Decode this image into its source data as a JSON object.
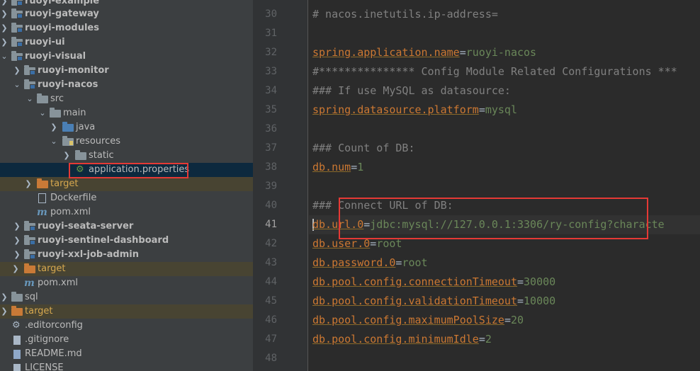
{
  "project_tree": {
    "items": [
      {
        "label": "ruoyi-example",
        "icon": "module-folder-icon"
      },
      {
        "label": "ruoyi-gateway",
        "icon": "module-folder-icon"
      },
      {
        "label": "ruoyi-modules",
        "icon": "module-folder-icon"
      },
      {
        "label": "ruoyi-ui",
        "icon": "module-folder-icon"
      },
      {
        "label": "ruoyi-visual",
        "icon": "module-folder-icon"
      },
      {
        "label": "ruoyi-monitor",
        "icon": "module-folder-icon"
      },
      {
        "label": "ruoyi-nacos",
        "icon": "module-folder-icon"
      },
      {
        "label": "src",
        "icon": "folder-icon"
      },
      {
        "label": "main",
        "icon": "folder-icon"
      },
      {
        "label": "java",
        "icon": "source-folder-icon"
      },
      {
        "label": "resources",
        "icon": "resources-folder-icon"
      },
      {
        "label": "static",
        "icon": "folder-icon"
      },
      {
        "label": "application.properties",
        "icon": "spring-properties-icon"
      },
      {
        "label": "target",
        "icon": "excluded-folder-icon"
      },
      {
        "label": "Dockerfile",
        "icon": "dockerfile-icon"
      },
      {
        "label": "pom.xml",
        "icon": "maven-icon"
      },
      {
        "label": "ruoyi-seata-server",
        "icon": "module-folder-icon"
      },
      {
        "label": "ruoyi-sentinel-dashboard",
        "icon": "module-folder-icon"
      },
      {
        "label": "ruoyi-xxl-job-admin",
        "icon": "module-folder-icon"
      },
      {
        "label": "target",
        "icon": "excluded-folder-icon"
      },
      {
        "label": "pom.xml",
        "icon": "maven-icon"
      },
      {
        "label": "sql",
        "icon": "folder-icon"
      },
      {
        "label": "target",
        "icon": "excluded-folder-icon"
      },
      {
        "label": ".editorconfig",
        "icon": "gear-icon"
      },
      {
        "label": ".gitignore",
        "icon": "file-icon"
      },
      {
        "label": "README.md",
        "icon": "markdown-icon"
      },
      {
        "label": "LICENSE",
        "icon": "file-icon"
      }
    ],
    "selected": "application.properties"
  },
  "editor": {
    "file": "application.properties",
    "cursor_line": 41,
    "lines": [
      {
        "n": "30",
        "comment": "# nacos.inetutils.ip-address="
      },
      {
        "n": "31"
      },
      {
        "n": "32",
        "key": "spring.application.name",
        "eq": "=",
        "value": "ruoyi-nacos"
      },
      {
        "n": "33",
        "comment": "#*************** Config Module Related Configurations ***"
      },
      {
        "n": "34",
        "comment": "### If use MySQL as datasource:"
      },
      {
        "n": "35",
        "key": "spring.datasource.platform",
        "eq": "=",
        "value": "mysql"
      },
      {
        "n": "36"
      },
      {
        "n": "37",
        "comment": "### Count of DB:"
      },
      {
        "n": "38",
        "key": "db.num",
        "eq": "=",
        "value": "1"
      },
      {
        "n": "39"
      },
      {
        "n": "40",
        "comment": "### Connect URL of DB:"
      },
      {
        "n": "41",
        "key": "db.url.0",
        "eq": "=",
        "value": "jdbc:mysql://127.0.0.1:3306/ry-config?characte"
      },
      {
        "n": "42",
        "key": "db.user.0",
        "eq": "=",
        "value": "root"
      },
      {
        "n": "43",
        "key": "db.password.0",
        "eq": "=",
        "value": "root"
      },
      {
        "n": "44",
        "key": "db.pool.config.connectionTimeout",
        "eq": "=",
        "value": "30000"
      },
      {
        "n": "45",
        "key": "db.pool.config.validationTimeout",
        "eq": "=",
        "value": "10000"
      },
      {
        "n": "46",
        "key": "db.pool.config.maximumPoolSize",
        "eq": "=",
        "value": "20"
      },
      {
        "n": "47",
        "key": "db.pool.config.minimumIdle",
        "eq": "=",
        "value": "2"
      },
      {
        "n": "48"
      }
    ]
  },
  "colors": {
    "tree_bg": "#3c3f41",
    "editor_bg": "#2b2b2b",
    "key": "#cc7832",
    "value": "#6a8759",
    "comment": "#808080",
    "highlight_box": "#e53935"
  }
}
